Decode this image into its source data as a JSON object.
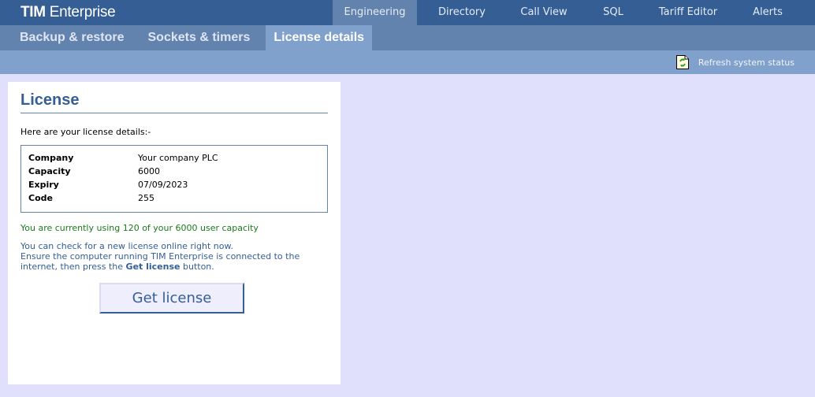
{
  "app": {
    "brand_bold": "TIM",
    "brand_rest": "Enterprise"
  },
  "topnav": {
    "items": [
      {
        "label": "Engineering",
        "active": true
      },
      {
        "label": "Directory",
        "active": false
      },
      {
        "label": "Call View",
        "active": false
      },
      {
        "label": "SQL",
        "active": false
      },
      {
        "label": "Tariff Editor",
        "active": false
      },
      {
        "label": "Alerts",
        "active": false
      }
    ]
  },
  "subnav": {
    "items": [
      {
        "label": "Backup & restore",
        "active": false
      },
      {
        "label": "Sockets & timers",
        "active": false
      },
      {
        "label": "License details",
        "active": true
      }
    ]
  },
  "statusbar": {
    "refresh_icon": "refresh-document-icon",
    "refresh_label": "Refresh system status"
  },
  "license": {
    "title": "License",
    "intro": "Here are your license details:-",
    "details": [
      {
        "key": "Company",
        "value": "Your company PLC"
      },
      {
        "key": "Capacity",
        "value": "6000"
      },
      {
        "key": "Expiry",
        "value": "07/09/2023"
      },
      {
        "key": "Code",
        "value": "255"
      }
    ],
    "usage_text": "You are currently using 120 of your 6000 user capacity",
    "help_line1": "You can check for a new license online right now.",
    "help_line2_pre": "Ensure the computer running TIM Enterprise is connected to the internet, then press the ",
    "help_line2_bold": "Get license",
    "help_line2_post": " button.",
    "button_label": "Get license"
  },
  "colors": {
    "header": "#345e94",
    "subheader": "#6183ad",
    "statusbar": "#7fa1cc",
    "background": "#e0e0fc",
    "usage_green": "#1a7a1a"
  }
}
